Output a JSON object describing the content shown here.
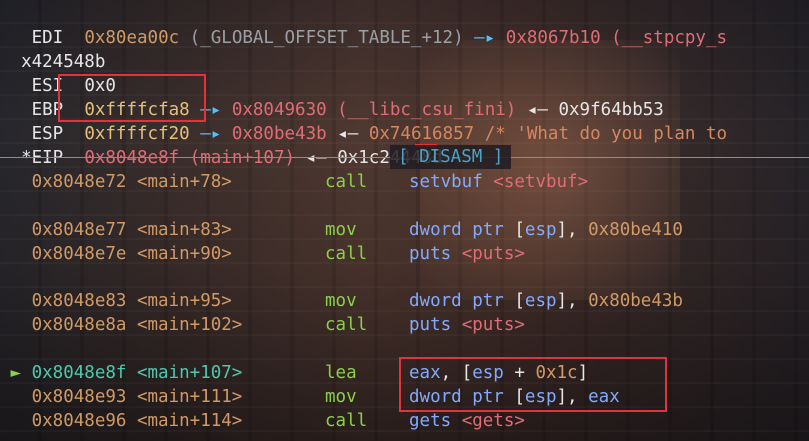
{
  "registers": {
    "edi": {
      "label": " EDI",
      "value": "0x80ea00c",
      "desc": " (_GLOBAL_OFFSET_TABLE_+12)",
      "arrow": " —▸ ",
      "target": "0x8067b10 (__stpcpy_s"
    },
    "wrap": "x424548b",
    "esi": {
      "label": " ESI",
      "value": "0x0"
    },
    "ebp": {
      "label": " EBP",
      "value": "0xffffcfa8",
      "arrow": " —▸ ",
      "target": "0x8049630 (__libc_csu_fini)",
      "back": " ◂— ",
      "back_val": "0x9f64bb53"
    },
    "esp": {
      "label": " ESP",
      "value": "0xffffcf20",
      "arrow": " —▸ ",
      "target": "0x80be43b",
      "back": " ◂— ",
      "back_val": "0x74616857 /* 'What do you plan to"
    },
    "eip": {
      "label": "*EIP",
      "value": "0x8048e8f",
      "desc": " (main+107)",
      "back": " ◂— ",
      "back_val": "0x1c24448d"
    }
  },
  "section_label": "[ DISASM ]",
  "disasm": [
    {
      "marker": "",
      "addr": "0x8048e72",
      "sym": "<main+78>",
      "op": "call",
      "args": [
        {
          "t": "setvbuf ",
          "c": "blue"
        },
        {
          "t": "<setvbuf>",
          "c": "pink"
        }
      ]
    },
    {
      "marker": "",
      "addr": "0x8048e77",
      "sym": "<main+83>",
      "op": "mov",
      "args": [
        {
          "t": "dword ptr ",
          "c": "blue"
        },
        {
          "t": "[",
          "c": "w"
        },
        {
          "t": "esp",
          "c": "blue"
        },
        {
          "t": "], ",
          "c": "w"
        },
        {
          "t": "0x80be410",
          "c": "num"
        }
      ]
    },
    {
      "marker": "",
      "addr": "0x8048e7e",
      "sym": "<main+90>",
      "op": "call",
      "args": [
        {
          "t": "puts ",
          "c": "blue"
        },
        {
          "t": "<puts>",
          "c": "pink"
        }
      ]
    },
    {
      "marker": "",
      "addr": "0x8048e83",
      "sym": "<main+95>",
      "op": "mov",
      "args": [
        {
          "t": "dword ptr ",
          "c": "blue"
        },
        {
          "t": "[",
          "c": "w"
        },
        {
          "t": "esp",
          "c": "blue"
        },
        {
          "t": "], ",
          "c": "w"
        },
        {
          "t": "0x80be43b",
          "c": "num"
        }
      ]
    },
    {
      "marker": "",
      "addr": "0x8048e8a",
      "sym": "<main+102>",
      "op": "call",
      "args": [
        {
          "t": "puts ",
          "c": "blue"
        },
        {
          "t": "<puts>",
          "c": "pink"
        }
      ]
    },
    {
      "marker": "►",
      "addr": "0x8048e8f",
      "sym": "<main+107>",
      "op": "lea",
      "args": [
        {
          "t": "eax",
          "c": "blue"
        },
        {
          "t": ", [",
          "c": "w"
        },
        {
          "t": "esp",
          "c": "blue"
        },
        {
          "t": " + ",
          "c": "w"
        },
        {
          "t": "0x1c",
          "c": "num"
        },
        {
          "t": "]",
          "c": "w"
        }
      ]
    },
    {
      "marker": "",
      "addr": "0x8048e93",
      "sym": "<main+111>",
      "op": "mov",
      "args": [
        {
          "t": "dword ptr ",
          "c": "blue"
        },
        {
          "t": "[",
          "c": "w"
        },
        {
          "t": "esp",
          "c": "blue"
        },
        {
          "t": "], ",
          "c": "w"
        },
        {
          "t": "eax",
          "c": "blue"
        }
      ]
    },
    {
      "marker": "",
      "addr": "0x8048e96",
      "sym": "<main+114>",
      "op": "call",
      "args": [
        {
          "t": "gets ",
          "c": "blue"
        },
        {
          "t": "<gets>",
          "c": "pink"
        }
      ]
    }
  ]
}
